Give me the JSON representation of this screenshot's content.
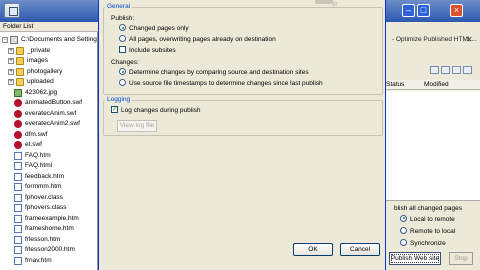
{
  "folder_list": {
    "header": "Folder List",
    "items": [
      {
        "label": "C:\\Documents and Setting",
        "type": "drive",
        "expander": "−"
      },
      {
        "label": "_private",
        "type": "folder",
        "expander": "+"
      },
      {
        "label": "images",
        "type": "folder",
        "expander": "+"
      },
      {
        "label": "photogallery",
        "type": "folder",
        "expander": "+"
      },
      {
        "label": "uploaded",
        "type": "folder",
        "expander": "+"
      },
      {
        "label": "423062.jpg",
        "type": "img",
        "expander": ""
      },
      {
        "label": "animatedButton.swf",
        "type": "swf",
        "expander": ""
      },
      {
        "label": "everatecAnim.swf",
        "type": "swf",
        "expander": ""
      },
      {
        "label": "everatecAnim2.swf",
        "type": "swf",
        "expander": ""
      },
      {
        "label": "dfm.swf",
        "type": "swf",
        "expander": ""
      },
      {
        "label": "et.swf",
        "type": "swf",
        "expander": ""
      },
      {
        "label": "FAQ.htm",
        "type": "doc",
        "expander": ""
      },
      {
        "label": "FAQ.html",
        "type": "doc",
        "expander": ""
      },
      {
        "label": "feedback.htm",
        "type": "doc",
        "expander": ""
      },
      {
        "label": "formmm.htm",
        "type": "doc",
        "expander": ""
      },
      {
        "label": "fphover.class",
        "type": "doc",
        "expander": ""
      },
      {
        "label": "fphovers.class",
        "type": "doc",
        "expander": ""
      },
      {
        "label": "frameexample.htm",
        "type": "doc",
        "expander": ""
      },
      {
        "label": "frameshome.htm",
        "type": "doc",
        "expander": ""
      },
      {
        "label": "frlesson.htm",
        "type": "doc",
        "expander": ""
      },
      {
        "label": "frlesson2000.htm",
        "type": "doc",
        "expander": ""
      },
      {
        "label": "frnav.htm",
        "type": "doc",
        "expander": ""
      }
    ]
  },
  "dialog": {
    "general_legend": "General",
    "publish_label": "Publish:",
    "publish_options": [
      {
        "label": "Changed pages only",
        "selected": true
      },
      {
        "label": "All pages, overwriting pages already on destination",
        "selected": false
      }
    ],
    "include_subsites": "Include subsites",
    "changes_label": "Changes:",
    "changes_options": [
      {
        "label": "Determine changes by comparing source and destination sites",
        "selected": true
      },
      {
        "label": "Use source file timestamps to determine changes since last publish",
        "selected": false
      }
    ],
    "logging_legend": "Logging",
    "log_changes": "Log changes during publish",
    "view_log_button": "View log file",
    "ok_button": "OK",
    "cancel_button": "Cancel"
  },
  "right_panel": {
    "title": "- Optimize Published HTML...",
    "col_status": "Status",
    "col_modified": "Modified",
    "status_text": "blish all changed pages",
    "radio_options": [
      {
        "label": "Local to remote",
        "selected": true
      },
      {
        "label": "Remote to local",
        "selected": false
      },
      {
        "label": "Synchronize",
        "selected": false
      }
    ],
    "publish_button": "Publish Web site",
    "stop_button": "Stop"
  },
  "colors": {
    "title_gradient_top": "#6b8dc8",
    "title_gradient_bottom": "#2d58b0",
    "legend_blue": "#0046d5",
    "dialog_bg": "#ece9d8"
  }
}
